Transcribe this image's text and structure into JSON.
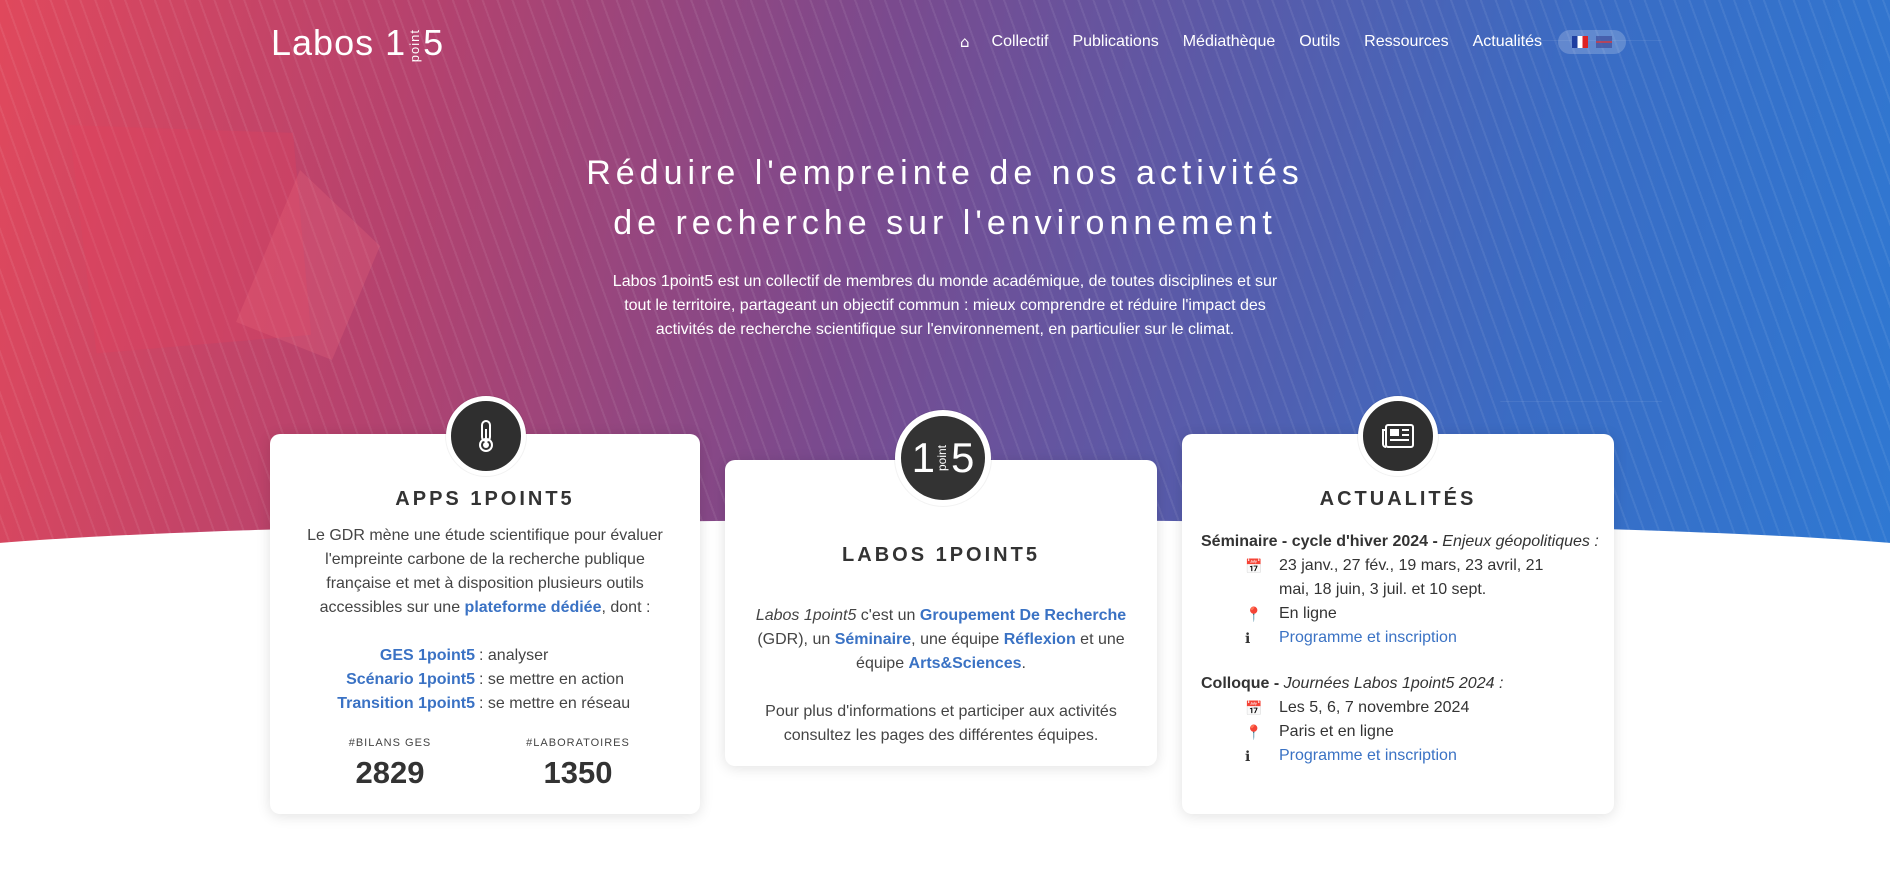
{
  "header": {
    "logo_text": "Labos 1point5",
    "nav": [
      "Collectif",
      "Publications",
      "Médiathèque",
      "Outils",
      "Ressources",
      "Actualités"
    ],
    "home_icon": "home-icon",
    "languages": [
      "fr",
      "en"
    ]
  },
  "hero": {
    "title_line1": "Réduire l'empreinte de nos activités",
    "title_line2": "de recherche sur l'environnement",
    "description": "Labos 1point5 est un collectif de membres du monde académique, de toutes disciplines et sur tout le territoire, partageant un objectif commun : mieux comprendre et réduire l'impact des activités de recherche scientifique sur l'environnement, en particulier sur le climat."
  },
  "apps_card": {
    "icon": "thermometer-icon",
    "title": "APPS 1POINT5",
    "intro_before": "Le GDR mène une étude scientifique pour évaluer l'empreinte carbone de la recherche publique française et met à disposition plusieurs outils accessibles sur une ",
    "intro_link": "plateforme dédiée",
    "intro_after": ", dont :",
    "tools": [
      {
        "name": "GES 1point5",
        "desc": " : analyser"
      },
      {
        "name": "Scénario 1point5",
        "desc": " : se mettre en action"
      },
      {
        "name": "Transition 1point5",
        "desc": " : se mettre en réseau"
      }
    ],
    "stats": [
      {
        "label": "#BILANS GES",
        "value": "2829"
      },
      {
        "label": "#LABORATOIRES",
        "value": "1350"
      }
    ]
  },
  "labos_card": {
    "logo_text": "1point5",
    "title": "LABOS 1POINT5",
    "p1_italic": "Labos 1point5",
    "p1_a": " c'est un ",
    "p1_link1": "Groupement De Recherche",
    "p1_b": " (GDR), un ",
    "p1_link2": "Séminaire",
    "p1_c": ", une équipe ",
    "p1_link3": "Réflexion",
    "p1_d": " et une équipe ",
    "p1_link4": "Arts&Sciences",
    "p1_e": ".",
    "p2": "Pour plus d'informations et participer aux activités consultez les pages des différentes équipes."
  },
  "news_card": {
    "icon": "newspaper-icon",
    "title": "ACTUALITÉS",
    "events": [
      {
        "type": "Séminaire - cycle d'hiver 2024 - ",
        "topic": "Enjeux géopolitiques :",
        "dates": "23 janv., 27 fév., 19 mars, 23 avril, 21 mai, 18 juin, 3 juil. et 10 sept.",
        "place": "En ligne",
        "link": "Programme et inscription"
      },
      {
        "type": "Colloque - ",
        "topic": "Journées Labos 1point5 2024 :",
        "dates": "Les 5, 6, 7 novembre 2024",
        "place": "Paris et en ligne",
        "link": "Programme et inscription"
      }
    ]
  }
}
